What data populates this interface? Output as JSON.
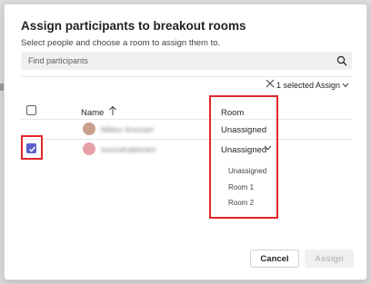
{
  "dialog": {
    "title": "Assign participants to breakout rooms",
    "subtitle": "Select people and choose a room to assign them to."
  },
  "search": {
    "placeholder": "Find participants",
    "icon": "search-icon"
  },
  "toolbar": {
    "selected_text": "1 selected",
    "assign_label": "Assign"
  },
  "table": {
    "header_name": "Name",
    "header_room": "Room",
    "rows": [
      {
        "name": "Mikko Ilmonen",
        "room": "Unassigned",
        "checked": false,
        "avatar_color": "#c9a08e"
      },
      {
        "name": "sunnahakkinen",
        "room": "Unassigned",
        "checked": true,
        "avatar_color": "#e7a1a6"
      }
    ]
  },
  "room_dropdown": {
    "options": [
      "Unassigned",
      "Room 1",
      "Room 2"
    ]
  },
  "footer": {
    "cancel_label": "Cancel",
    "assign_label": "Assign"
  },
  "colors": {
    "accent": "#5b5fc7",
    "highlight": "#e0262a"
  }
}
